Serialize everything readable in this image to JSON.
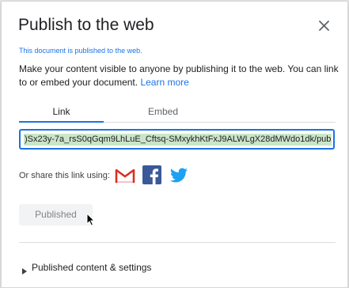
{
  "dialog": {
    "title": "Publish to the web",
    "notice": "This document is published to the web.",
    "description": "Make your content visible to anyone by publishing it to the web. You can link to or embed your document.",
    "learn_more": "Learn more"
  },
  "tabs": [
    {
      "label": "Link",
      "active": true
    },
    {
      "label": "Embed",
      "active": false
    }
  ],
  "link": {
    "url_value": ")Sx23y-7a_rsS0qGqm9LhLuE_Cftsq-SMxykhKtFxJ9ALWLgX28dMWdo1dk/pub"
  },
  "share": {
    "label": "Or share this link using:",
    "services": [
      {
        "name": "Gmail",
        "icon": "gmail-icon"
      },
      {
        "name": "Facebook",
        "icon": "facebook-icon"
      },
      {
        "name": "Twitter",
        "icon": "twitter-icon"
      }
    ]
  },
  "published_button": "Published",
  "settings_section": "Published content & settings",
  "colors": {
    "accent": "#1a73e8",
    "gmail_red": "#d93025",
    "facebook_blue": "#3b5998",
    "twitter_blue": "#1da1f2"
  }
}
